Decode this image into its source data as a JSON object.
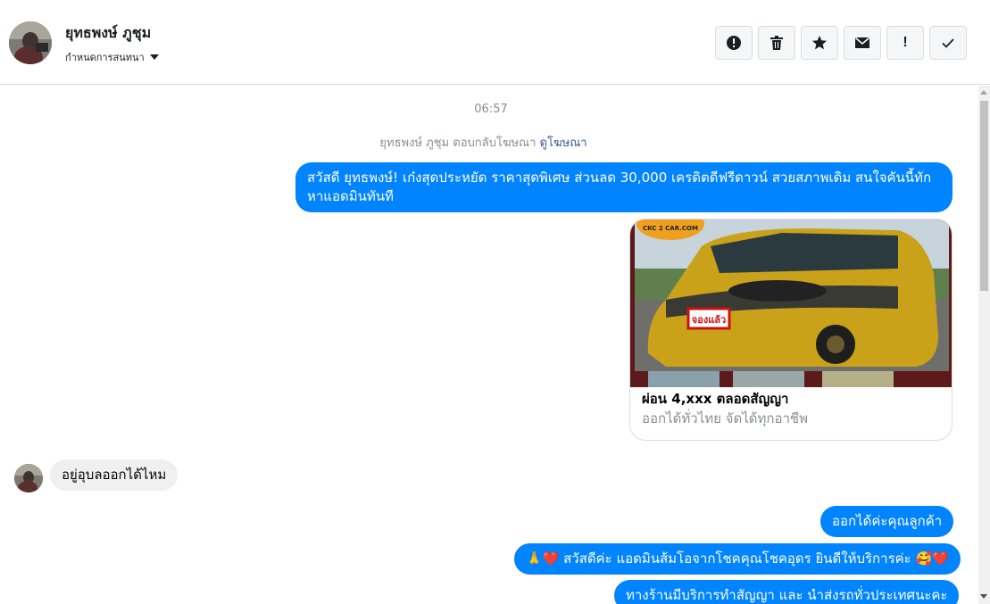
{
  "header": {
    "contact_name": "ยุทธพงษ์ ภูชุม",
    "assign_label": "กำหนดการสนทนา",
    "actions": [
      {
        "name": "spam-button",
        "icon": "alert-circle-icon"
      },
      {
        "name": "delete-button",
        "icon": "trash-icon"
      },
      {
        "name": "star-button",
        "icon": "star-icon"
      },
      {
        "name": "mark-unread-button",
        "icon": "envelope-icon"
      },
      {
        "name": "priority-button",
        "label": "!"
      },
      {
        "name": "done-button",
        "icon": "check-icon"
      }
    ]
  },
  "thread": {
    "timestamp": "06:57",
    "reply_note": "ยุทธพงษ์ ภูชุม ตอบกลับโฆษณา",
    "reply_link": "ดูโฆษณา",
    "messages": [
      {
        "from": "page",
        "text": "สวัสดี ยุทธพงษ์! เก๋งสุดประหยัด ราคาสุดพิเศษ ส่วนลด 30,000 เครดิตดีฟรีดาวน์ สวยสภาพเดิม สนใจคันนี้ทัก หาแอดมินทันที"
      },
      {
        "from": "user",
        "text": "อยู่อุบลออกได้ไหม"
      },
      {
        "from": "page",
        "text": "ออกได้ค่ะคุณลูกค้า"
      },
      {
        "from": "page",
        "text": "🙏❤️ สวัสดีค่ะ แอดมินส้มโอจากโชคคุณโชคอุดร ยินดีให้บริการค่ะ 🥰❤️"
      },
      {
        "from": "page",
        "text": "ทางร้านมีบริการทำสัญญา และ นำส่งรถทั่วประเทศนะคะ"
      }
    ],
    "ad_card": {
      "title": "ผ่อน 4,xxx ตลอดสัญญา",
      "subtitle": "ออกได้ทั่วไทย จัดได้ทุกอาชีพ",
      "logo_text": "CKC 2 CAR.COM",
      "plate_text": "จองแล้ว",
      "car_color": "#c9a21a"
    }
  },
  "colors": {
    "outgoing_bubble": "#0084ff",
    "incoming_bubble": "#f0f0f0",
    "link": "#385898"
  }
}
